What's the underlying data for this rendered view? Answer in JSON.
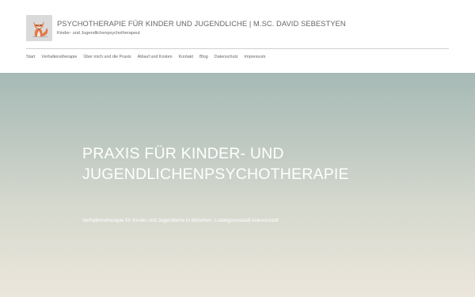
{
  "header": {
    "title": "PSYCHOTHERAPIE FÜR KINDER UND JUGENDLICHE | M.SC. DAVID SEBESTYEN",
    "tagline": "Kinder- und Jugendlichenpsychotherapeut",
    "logo_icon": "fox-icon"
  },
  "nav": {
    "items": [
      {
        "label": "Start"
      },
      {
        "label": "Verhaltenstherapie"
      },
      {
        "label": "Über mich und die Praxis"
      },
      {
        "label": "Ablauf und Kosten"
      },
      {
        "label": "Kontakt"
      },
      {
        "label": "Blog"
      },
      {
        "label": "Datenschutz"
      },
      {
        "label": "Impressum"
      }
    ]
  },
  "hero": {
    "title": "PRAXIS FÜR KINDER- UND JUGENDLICHENPSYCHOTHERAPIE",
    "subtitle": "Verhaltenstherapie für Kinder und Jugendliche in München, Ludwigsvorstadt-Isarvorstadt"
  },
  "colors": {
    "hero_top": "#a7bab6",
    "hero_bottom": "#ece6dc",
    "text": "#666666",
    "fox": "#e07a4a"
  }
}
